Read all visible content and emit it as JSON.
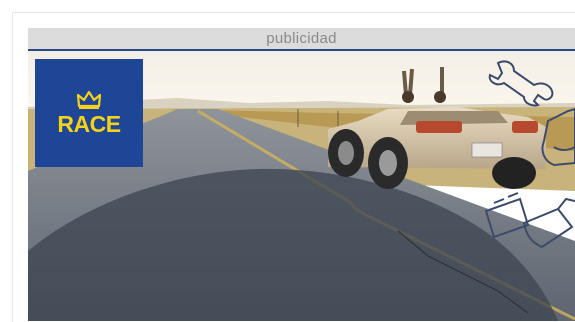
{
  "ad_label": "publicidad",
  "brand": {
    "logo_text": "RACE",
    "logo_bg": "#1f4596",
    "logo_fg": "#f4d21a"
  },
  "icons": [
    "crown-icon",
    "wrench-icon",
    "oil-can-icon",
    "car-battery-icon",
    "jerrycan-icon"
  ]
}
